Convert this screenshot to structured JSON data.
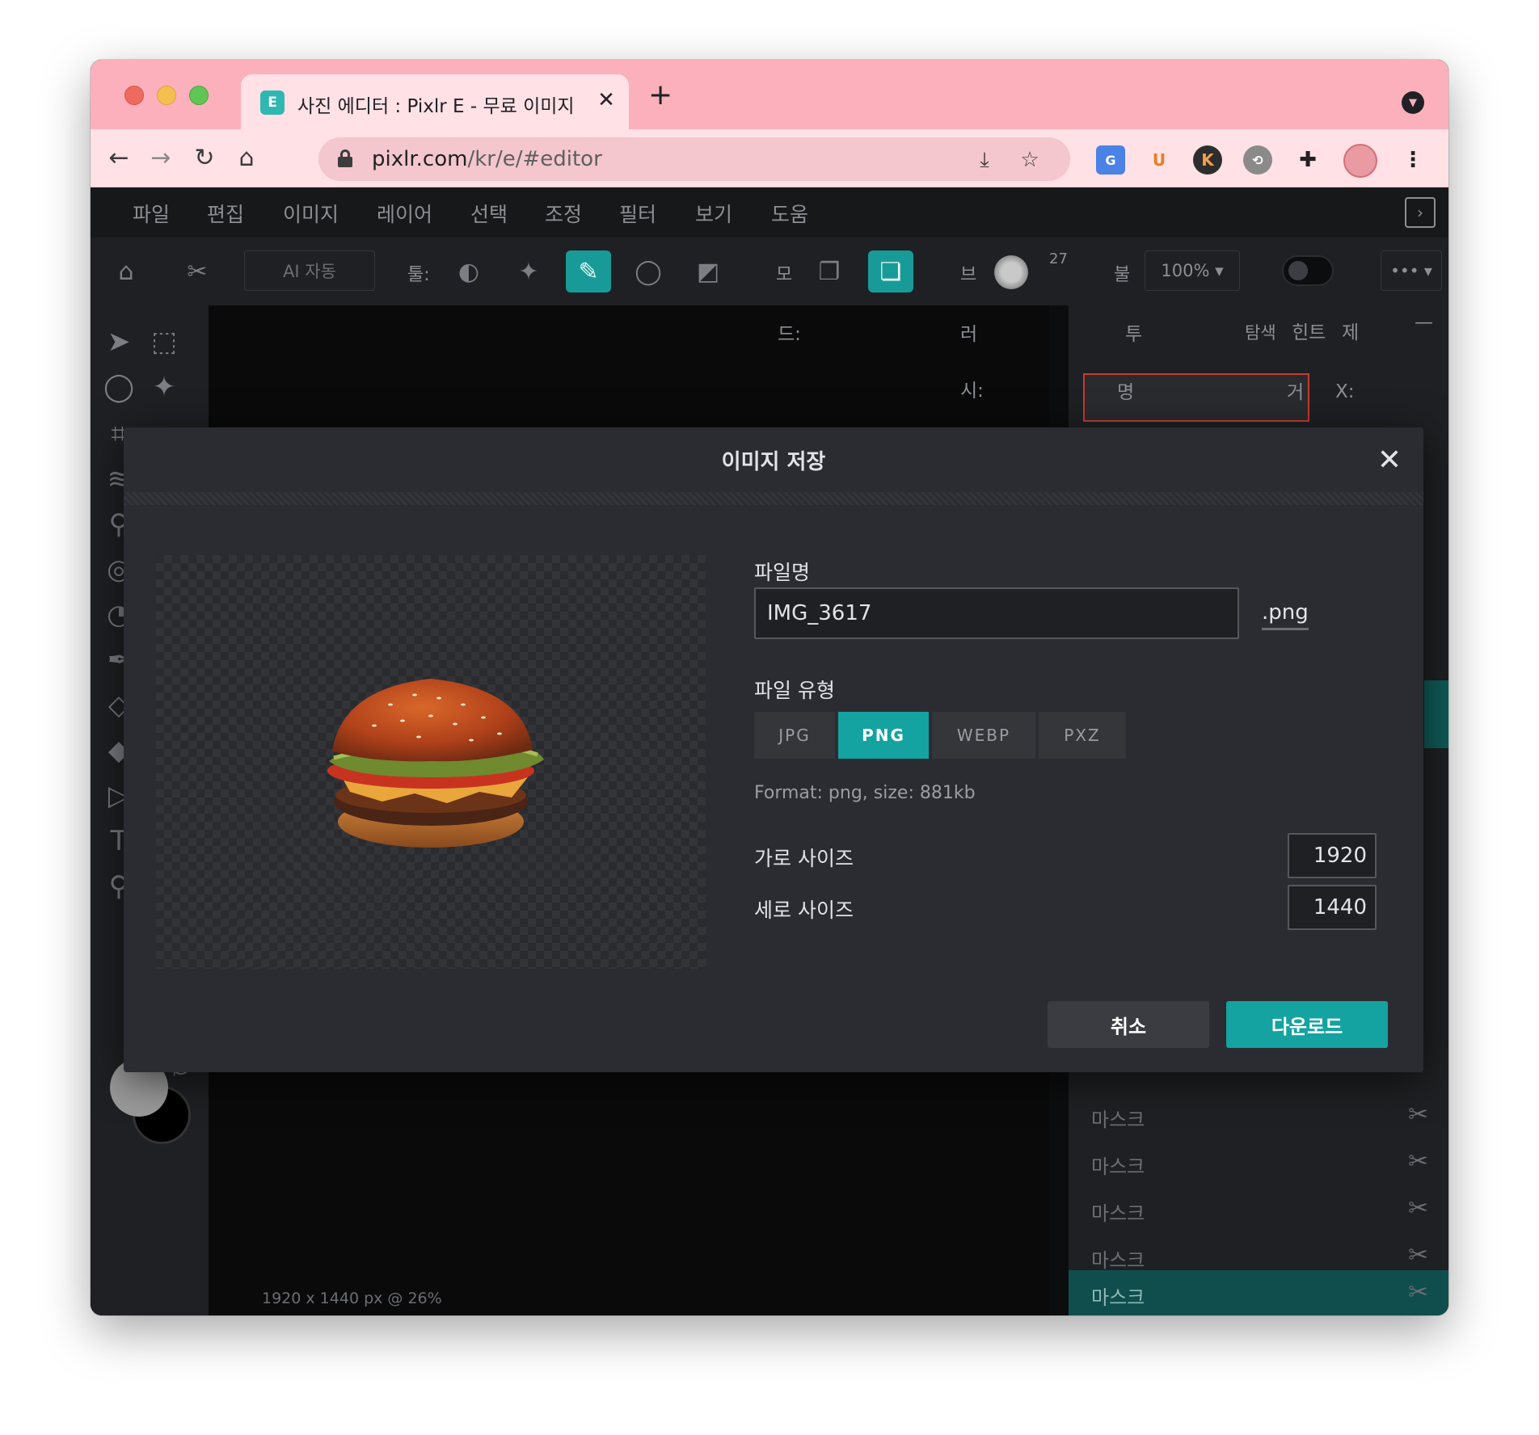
{
  "browser": {
    "tab_title": "사진 에디터 : Pixlr E - 무료 이미지 편집기",
    "tab_close": "✕",
    "new_tab": "+",
    "url_host": "pixlr.com",
    "url_path": "/kr/e/#editor",
    "ext_u": "U",
    "ext_k": "K"
  },
  "menubar": {
    "items": [
      "파일",
      "편집",
      "이미지",
      "레이어",
      "선택",
      "조정",
      "필터",
      "보기",
      "도움"
    ]
  },
  "toolbar": {
    "ai_label": "AI 자동",
    "tool_label": "툴:",
    "mode_label": "모",
    "brush_label": "브",
    "brush_size": "27",
    "opacity_label": "불",
    "zoom": "100% ▾",
    "more": "••• ▾"
  },
  "canvas": {
    "mode_label_2": "드:",
    "brush_label_2": "러",
    "display_label": "시:",
    "status": "1920 x 1440 px @ 26%"
  },
  "right_panel": {
    "tab_opacity": "투",
    "tab_explore": "탐색",
    "tab_hints": "힌트",
    "tab_remove": "제",
    "thumb_label_1": "명",
    "thumb_label_2": "거",
    "x_label": "X:",
    "layers": [
      "마스크",
      "마스크",
      "마스크",
      "마스크",
      "마스크"
    ]
  },
  "dialog": {
    "title": "이미지 저장",
    "filename_label": "파일명",
    "filename_value": "IMG_3617",
    "extension": ".png",
    "filetype_label": "파일 유형",
    "formats": [
      "JPG",
      "PNG",
      "WEBP",
      "PXZ"
    ],
    "selected_format": "PNG",
    "format_info": "Format: png, size: 881kb",
    "width_label": "가로 사이즈",
    "width_value": "1920",
    "height_label": "세로 사이즈",
    "height_value": "1440",
    "cancel": "취소",
    "download": "다운로드"
  },
  "colors": {
    "accent": "#14a3a0",
    "tabbar": "#fcb0bc",
    "toolbar": "#ffe1e6"
  }
}
